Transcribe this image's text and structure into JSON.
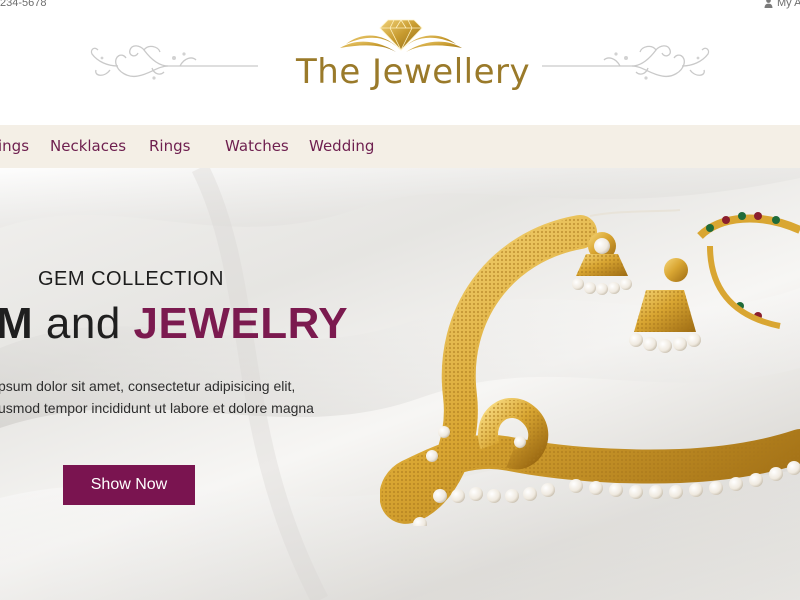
{
  "topbar": {
    "phone": "234-5678",
    "account_label": "My A"
  },
  "logo": {
    "text": "The Jewellery"
  },
  "nav": {
    "items": [
      {
        "label": "ings"
      },
      {
        "label": "Necklaces"
      },
      {
        "label": "Rings"
      },
      {
        "label": "Watches"
      },
      {
        "label": "Wedding"
      }
    ]
  },
  "hero": {
    "kicker": "GEM COLLECTION",
    "title_part1": "M",
    "title_part2": " and ",
    "title_part3": "JEWELRY",
    "line1": "psum dolor sit amet, consectetur adipisicing elit,",
    "line2": "usmod tempor incididunt ut labore et dolore magna",
    "cta_label": "Show Now"
  },
  "colors": {
    "brand_plum": "#7a1450",
    "nav_text": "#6e1f4f",
    "nav_bg": "#f4efe6",
    "gold": "#c79a2e"
  },
  "icons": {
    "user": "user-icon",
    "logo": "diamond-crown-icon"
  }
}
